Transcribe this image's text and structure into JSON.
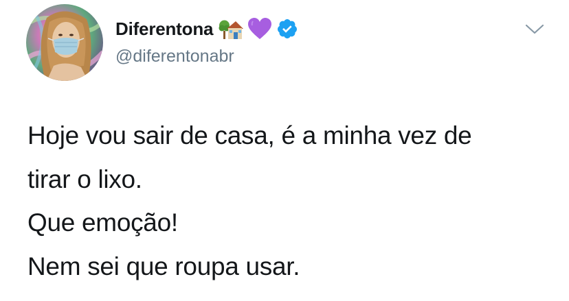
{
  "tweet": {
    "author": {
      "display_name": "Diferentona",
      "handle": "@diferentonabr",
      "verified": true,
      "name_emojis": [
        "house-with-tree-emoji",
        "purple-heart-emoji"
      ],
      "verified_badge_color": "#1da1f2"
    },
    "text_lines": [
      "Hoje vou sair de casa, é a minha vez de",
      "tirar o lixo.",
      "Que emoção!",
      "Nem sei que roupa usar."
    ],
    "menu_icon": "chevron-down-icon"
  },
  "colors": {
    "text": "#14171a",
    "secondary_text": "#657786",
    "caret": "#8899a6",
    "background": "#ffffff"
  }
}
